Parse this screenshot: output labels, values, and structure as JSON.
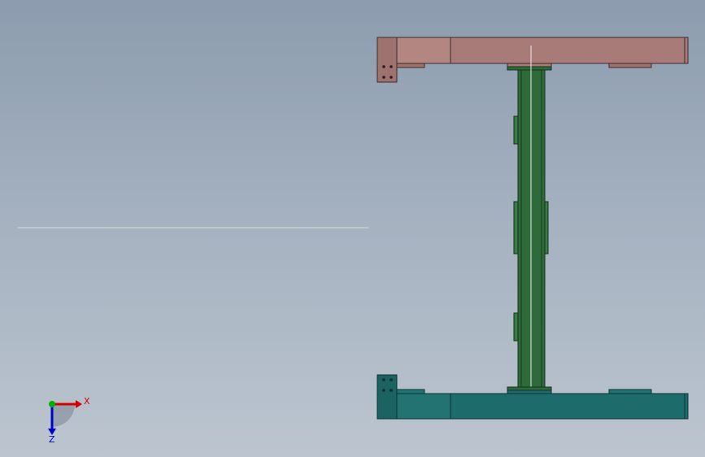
{
  "viewport": {
    "background_top": "#8c9cae",
    "background_bottom": "#bcc5cf"
  },
  "model": {
    "top_beam": {
      "fill": "#a87b78",
      "stroke": "#3a2a2a"
    },
    "column": {
      "fill": "#2f6b3a",
      "stroke": "#12331a"
    },
    "bottom_beam": {
      "fill": "#1e6b6b",
      "stroke": "#0d3333"
    }
  },
  "triad": {
    "x_label": "X",
    "z_label": "Z",
    "x_color": "#d40000",
    "y_color": "#00b000",
    "z_color": "#0000d0"
  }
}
